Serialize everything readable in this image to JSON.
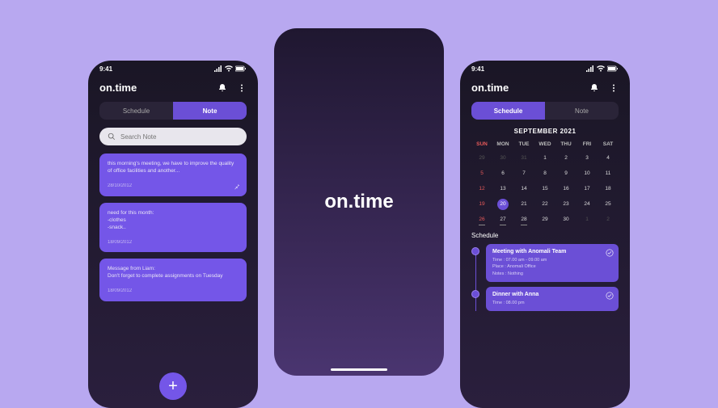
{
  "status": {
    "time": "9:41"
  },
  "app": {
    "title": "on.time"
  },
  "tabs": {
    "schedule": "Schedule",
    "note": "Note"
  },
  "search": {
    "placeholder": "Search Note"
  },
  "notes": [
    {
      "text": "this morning's meeting, we have to improve the quality of office facilities and another...",
      "date": "28/10/2012"
    },
    {
      "text": "need for this month:\n-clothes\n-snack..",
      "date": "18/09/2012"
    },
    {
      "text": "Message from Liam:\nDon't forget to complete assignments on Tuesday",
      "date": "18/09/2012"
    }
  ],
  "splash": {
    "title": "on.time"
  },
  "calendar": {
    "title": "SEPTEMBER 2021",
    "dow": [
      "SUN",
      "MON",
      "TUE",
      "WED",
      "THU",
      "FRI",
      "SAT"
    ],
    "weeks": [
      [
        {
          "d": "29",
          "prev": true
        },
        {
          "d": "30",
          "prev": true
        },
        {
          "d": "31",
          "prev": true
        },
        {
          "d": "1"
        },
        {
          "d": "2"
        },
        {
          "d": "3"
        },
        {
          "d": "4"
        }
      ],
      [
        {
          "d": "5",
          "sun": true
        },
        {
          "d": "6"
        },
        {
          "d": "7"
        },
        {
          "d": "8"
        },
        {
          "d": "9"
        },
        {
          "d": "10"
        },
        {
          "d": "11"
        }
      ],
      [
        {
          "d": "12",
          "sun": true
        },
        {
          "d": "13"
        },
        {
          "d": "14"
        },
        {
          "d": "15"
        },
        {
          "d": "16"
        },
        {
          "d": "17"
        },
        {
          "d": "18"
        }
      ],
      [
        {
          "d": "19",
          "sun": true
        },
        {
          "d": "20",
          "selected": true
        },
        {
          "d": "21"
        },
        {
          "d": "22"
        },
        {
          "d": "23"
        },
        {
          "d": "24"
        },
        {
          "d": "25"
        }
      ],
      [
        {
          "d": "26",
          "sun": true,
          "underline": true
        },
        {
          "d": "27",
          "underline": true
        },
        {
          "d": "28",
          "underline": true
        },
        {
          "d": "29"
        },
        {
          "d": "30"
        },
        {
          "d": "1",
          "prev": true
        },
        {
          "d": "2",
          "prev": true
        }
      ]
    ]
  },
  "schedule": {
    "label": "Schedule",
    "events": [
      {
        "title": "Meeting with Anomali Team",
        "time_label": "Time :",
        "time": "07.00 am - 09.00 am",
        "place_label": "Place :",
        "place": "Anomali Office",
        "notes_label": "Notes :",
        "notes": "Nothing"
      },
      {
        "title": "Dinner with Anna",
        "time_label": "Time :",
        "time": "08.00 pm"
      }
    ]
  }
}
